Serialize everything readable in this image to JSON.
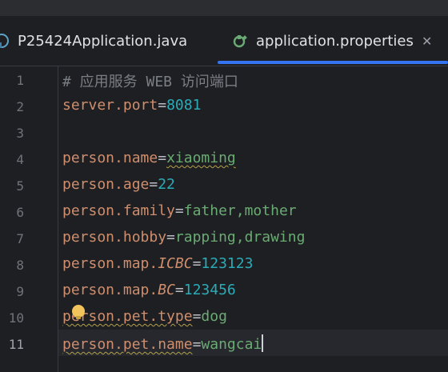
{
  "tabs": [
    {
      "label": "P25424Application.java",
      "icon": "java-class-icon",
      "active": false
    },
    {
      "label": "application.properties",
      "icon": "properties-icon",
      "active": true
    }
  ],
  "close_glyph": "✕",
  "line_numbers": [
    "1",
    "2",
    "3",
    "4",
    "5",
    "6",
    "7",
    "8",
    "9",
    "10",
    "11"
  ],
  "lines": [
    {
      "comment": "# 应用服务 WEB 访问端口"
    },
    {
      "key": "server.port",
      "eq": "=",
      "value": "8081"
    },
    {},
    {
      "key": "person.name",
      "eq": "=",
      "value": "xiaoming"
    },
    {
      "key": "person.age",
      "eq": "=",
      "value": "22"
    },
    {
      "key": "person.family",
      "eq": "=",
      "value": "father,mother"
    },
    {
      "key": "person.hobby",
      "eq": "=",
      "value": "rapping,drawing"
    },
    {
      "key_a": "person.map.",
      "key_b": "ICBC",
      "eq": "=",
      "value": "123123"
    },
    {
      "key_a": "person.map.",
      "key_b": "BC",
      "eq": "=",
      "value": "123456"
    },
    {
      "key": "person.pet.type",
      "eq": "=",
      "value": "dog"
    },
    {
      "key": "person.pet.name",
      "eq": "=",
      "value": "wangcai"
    }
  ],
  "colors": {
    "key": "#cf8e6d",
    "string": "#6aab73",
    "number": "#2aacb8",
    "comment": "#7a7e85",
    "accent": "#3574f0"
  }
}
